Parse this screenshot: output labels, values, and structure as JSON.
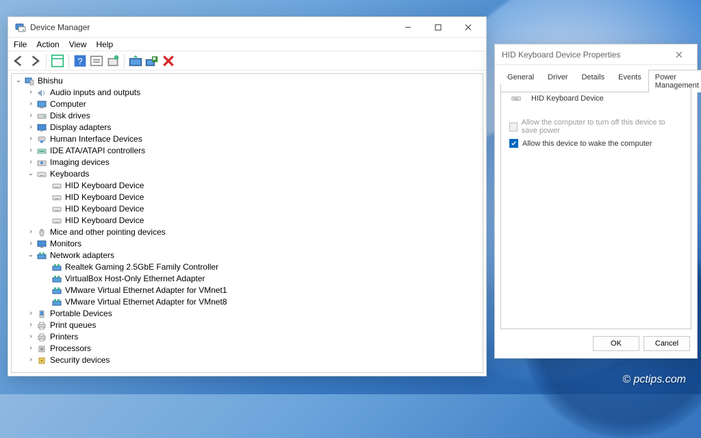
{
  "watermark": "© pctips.com",
  "device_manager": {
    "title": "Device Manager",
    "menu": {
      "file": "File",
      "action": "Action",
      "view": "View",
      "help": "Help"
    },
    "root": "Bhishu",
    "categories": [
      {
        "label": "Audio inputs and outputs",
        "expanded": false,
        "kind": "audio"
      },
      {
        "label": "Computer",
        "expanded": false,
        "kind": "computer"
      },
      {
        "label": "Disk drives",
        "expanded": false,
        "kind": "disk"
      },
      {
        "label": "Display adapters",
        "expanded": false,
        "kind": "display"
      },
      {
        "label": "Human Interface Devices",
        "expanded": false,
        "kind": "hid"
      },
      {
        "label": "IDE ATA/ATAPI controllers",
        "expanded": false,
        "kind": "ide"
      },
      {
        "label": "Imaging devices",
        "expanded": false,
        "kind": "imaging"
      },
      {
        "label": "Keyboards",
        "expanded": true,
        "kind": "keyboard",
        "children": [
          {
            "label": "HID Keyboard Device"
          },
          {
            "label": "HID Keyboard Device"
          },
          {
            "label": "HID Keyboard Device"
          },
          {
            "label": "HID Keyboard Device"
          }
        ]
      },
      {
        "label": "Mice and other pointing devices",
        "expanded": false,
        "kind": "mouse"
      },
      {
        "label": "Monitors",
        "expanded": false,
        "kind": "monitor"
      },
      {
        "label": "Network adapters",
        "expanded": true,
        "kind": "net",
        "children": [
          {
            "label": "Realtek Gaming 2.5GbE Family Controller"
          },
          {
            "label": "VirtualBox Host-Only Ethernet Adapter"
          },
          {
            "label": "VMware Virtual Ethernet Adapter for VMnet1"
          },
          {
            "label": "VMware Virtual Ethernet Adapter for VMnet8"
          }
        ]
      },
      {
        "label": "Portable Devices",
        "expanded": false,
        "kind": "portable"
      },
      {
        "label": "Print queues",
        "expanded": false,
        "kind": "printq"
      },
      {
        "label": "Printers",
        "expanded": false,
        "kind": "printer"
      },
      {
        "label": "Processors",
        "expanded": false,
        "kind": "cpu"
      },
      {
        "label": "Security devices",
        "expanded": false,
        "kind": "security"
      }
    ]
  },
  "properties": {
    "title": "HID Keyboard Device Properties",
    "tabs": {
      "general": "General",
      "driver": "Driver",
      "details": "Details",
      "events": "Events",
      "power": "Power Management"
    },
    "active_tab": "power",
    "device_name": "HID Keyboard Device",
    "chk_turn_off": "Allow the computer to turn off this device to save power",
    "chk_wake": "Allow this device to wake the computer",
    "chk_turn_off_enabled": false,
    "chk_turn_off_checked": false,
    "chk_wake_checked": true,
    "ok": "OK",
    "cancel": "Cancel"
  }
}
